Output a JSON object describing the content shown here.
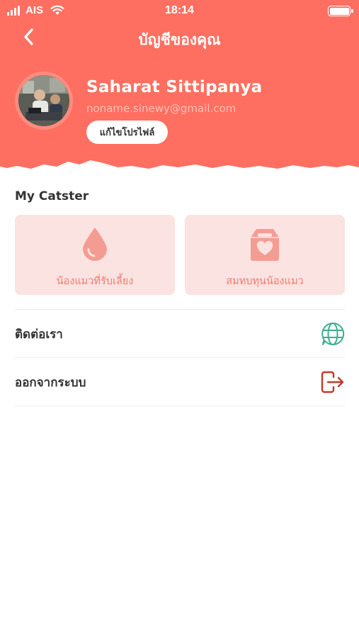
{
  "status_bar": {
    "carrier": "AIS",
    "time": "18:14",
    "signal_bars": 4,
    "icons": [
      "signal-icon",
      "wifi-icon",
      "battery-icon"
    ]
  },
  "nav": {
    "title": "บัญชีของคุณ",
    "back_icon": "chevron-left-icon"
  },
  "profile": {
    "name": "Saharat Sittipanya",
    "email": "noname.sinewy@gmail.com",
    "edit_label": "แก้ไขโปรไฟล์"
  },
  "section": {
    "title": "My Catster",
    "cards": [
      {
        "label": "น้องแมวที่รับเลี้ยง",
        "icon": "drop-icon"
      },
      {
        "label": "สมทบทุนน้องแมว",
        "icon": "donation-box-icon"
      }
    ]
  },
  "menu": [
    {
      "label": "ติดต่อเรา",
      "icon": "globe-chat-icon"
    },
    {
      "label": "ออกจากระบบ",
      "icon": "logout-icon"
    }
  ],
  "colors": {
    "header": "#fe6f61",
    "card_bg": "#fbe3e1",
    "card_icon": "#f59c92",
    "card_text": "#f07a70",
    "contact_icon": "#3fae8f",
    "logout_icon": "#c0392b"
  }
}
